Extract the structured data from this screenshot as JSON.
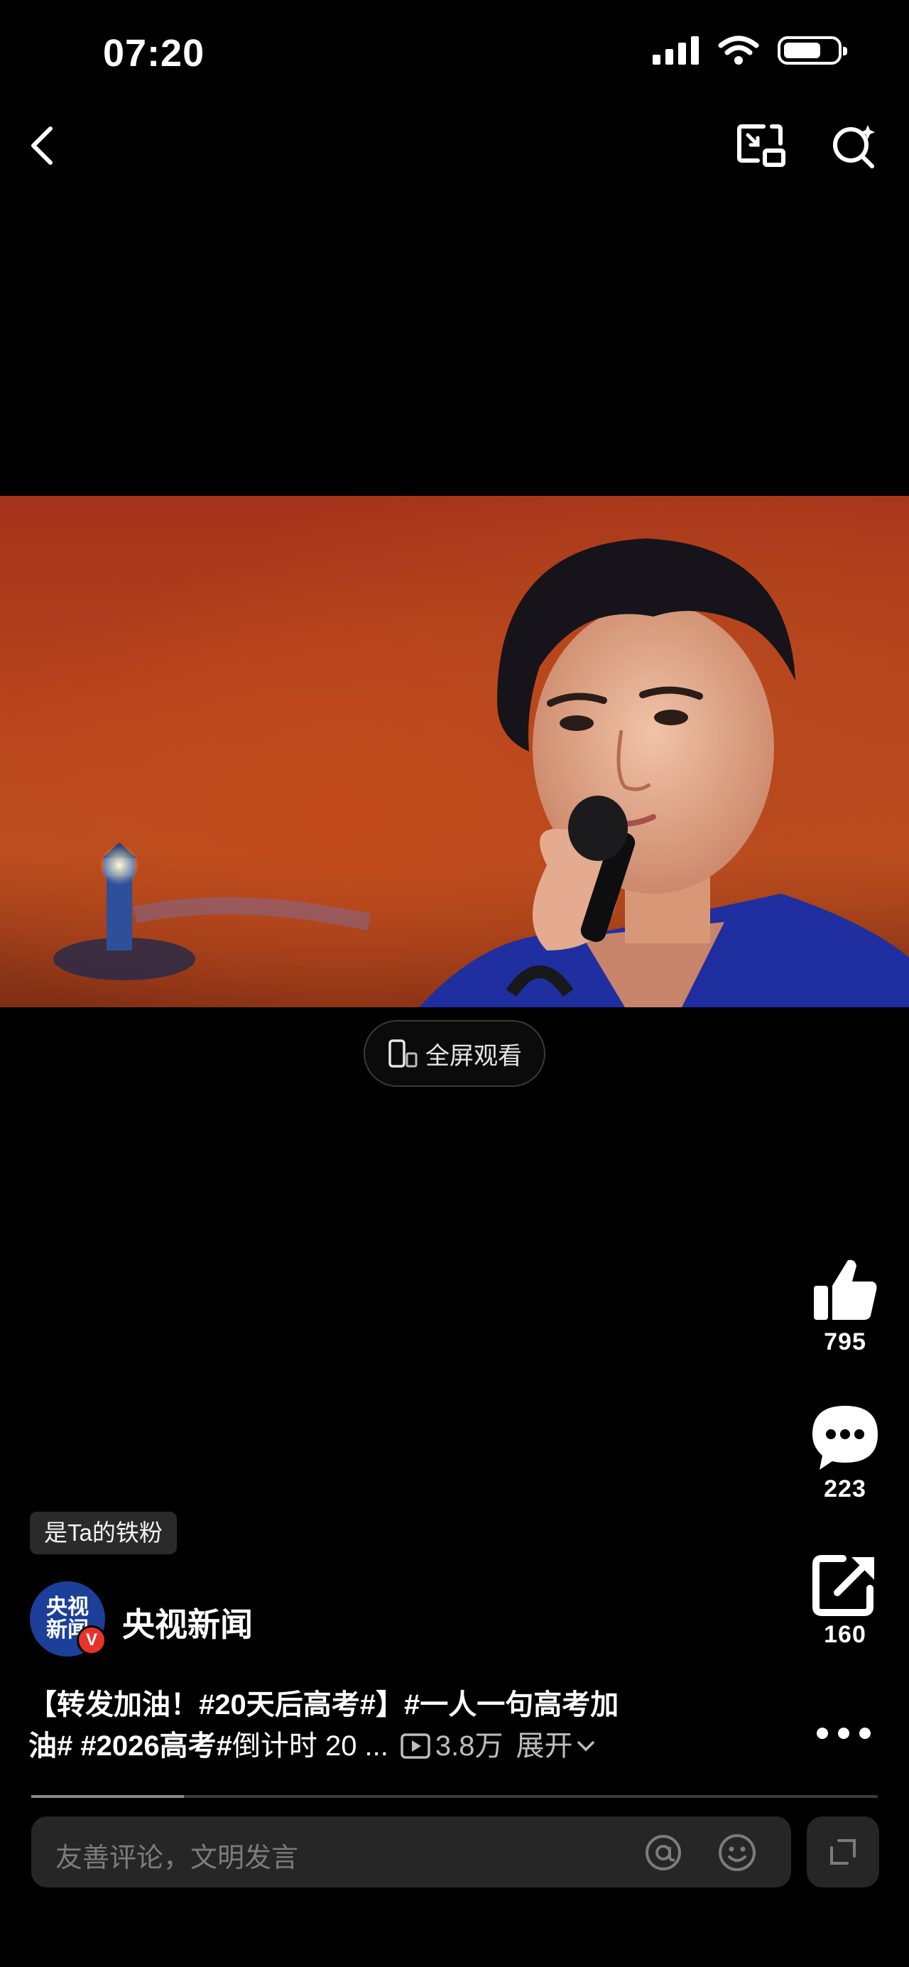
{
  "status_bar": {
    "time": "07:20"
  },
  "video": {
    "fullscreen_label": "全屏观看"
  },
  "actions": {
    "likes": "795",
    "comments": "223",
    "shares": "160"
  },
  "fan_tag": "是Ta的铁粉",
  "author": {
    "name": "央视新闻",
    "avatar_text_line1": "央视",
    "avatar_text_line2": "新闻",
    "badge": "V"
  },
  "description": {
    "line1": "【转发加油！#20天后高考#】#一人一句高考加",
    "line2_bold": "油# #2026高考#",
    "line2_rest": "倒计时 20 ...",
    "views": "3.8万",
    "expand": "展开"
  },
  "playback": {
    "progress": 0.18
  },
  "comment_input": {
    "placeholder": "友善评论，文明发言"
  }
}
